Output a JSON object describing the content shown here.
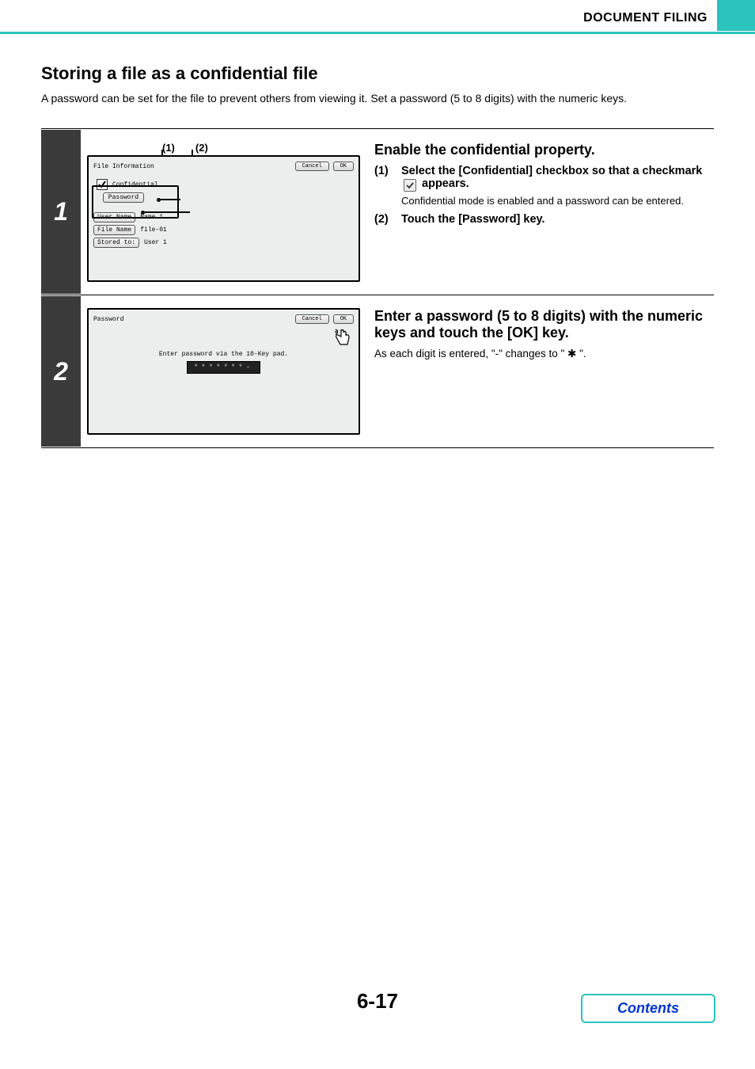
{
  "header": {
    "breadcrumb": "DOCUMENT FILING"
  },
  "section": {
    "title": "Storing a file as a confidential file",
    "intro": "A password can be set for the file to prevent others from viewing it. Set a password (5 to 8 digits) with the numeric keys."
  },
  "step1": {
    "number": "1",
    "markers": [
      "(1)",
      "(2)"
    ],
    "figure": {
      "title": "File Information",
      "cancel": "Cancel",
      "ok": "OK",
      "confidential_label": "Confidential",
      "password_btn": "Password",
      "rows": [
        {
          "label": "User Name",
          "value": "Name 1"
        },
        {
          "label": "File Name",
          "value": "file-01"
        },
        {
          "label": "Stored to:",
          "value": "User 1"
        }
      ]
    },
    "heading": "Enable the confidential property.",
    "items": [
      {
        "num": "(1)",
        "head_a": "Select the [Confidential] checkbox so that a checkmark ",
        "head_b": " appears.",
        "sub": "Confidential mode is enabled and a password can be entered."
      },
      {
        "num": "(2)",
        "head": "Touch the [Password] key."
      }
    ]
  },
  "step2": {
    "number": "2",
    "figure": {
      "title": "Password",
      "cancel": "Cancel",
      "ok": "OK",
      "instruction": "Enter password via the 10-Key pad.",
      "display": "*******-"
    },
    "heading": "Enter a password (5 to 8 digits) with the numeric keys and touch the [OK] key.",
    "desc_a": "As each digit is entered, \"-\" changes to \" ",
    "desc_b": " \"."
  },
  "footer": {
    "page": "6-17",
    "contents": "Contents"
  }
}
